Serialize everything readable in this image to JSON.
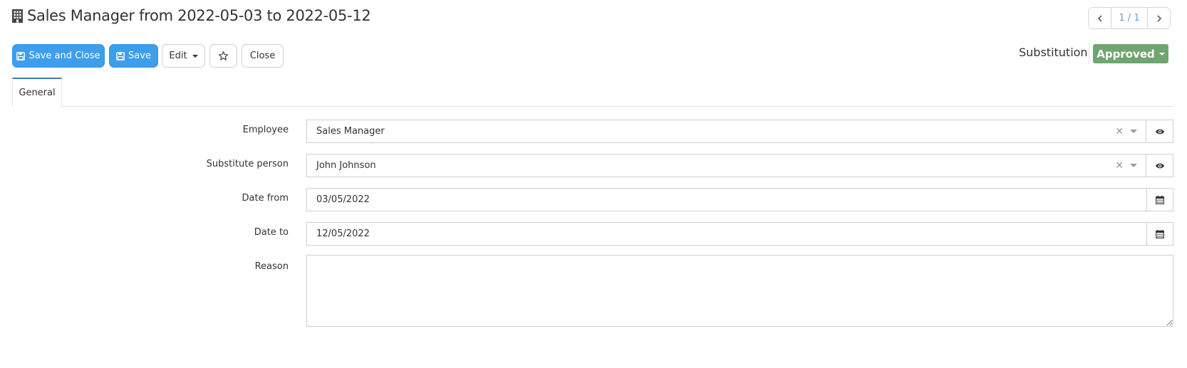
{
  "header": {
    "title": "Sales Manager from 2022-05-03 to 2022-05-12",
    "title_icon": "building-icon",
    "pager": {
      "count": "1 / 1"
    }
  },
  "toolbar": {
    "save_and_close_label": "Save and Close",
    "save_label": "Save",
    "edit_label": "Edit",
    "close_label": "Close"
  },
  "status": {
    "label": "Substitution",
    "value": "Approved",
    "color": "#6fa56f"
  },
  "tabs": [
    {
      "label": "General",
      "active": true
    }
  ],
  "form": {
    "employee": {
      "label": "Employee",
      "value": "Sales Manager"
    },
    "substitute": {
      "label": "Substitute person",
      "value": "John Johnson"
    },
    "date_from": {
      "label": "Date from",
      "value": "03/05/2022"
    },
    "date_to": {
      "label": "Date to",
      "value": "12/05/2022"
    },
    "reason": {
      "label": "Reason",
      "value": ""
    }
  },
  "colors": {
    "primary": "#3d9eec",
    "approved": "#6fa56f",
    "pager_text": "#6a9ecf"
  }
}
